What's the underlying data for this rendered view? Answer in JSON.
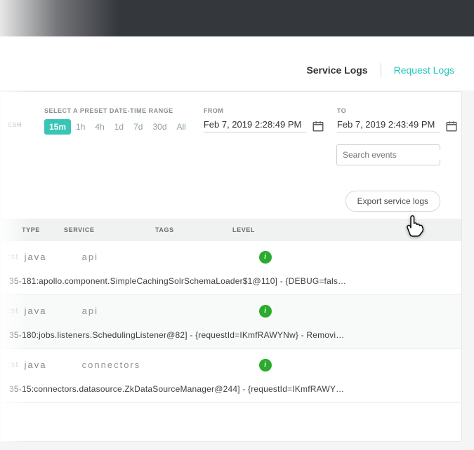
{
  "tabs": {
    "active": "Service Logs",
    "inactive": "Request Logs"
  },
  "filters": {
    "refresh_partial": "ESH",
    "preset_label": "SELECT A PRESET DATE-TIME RANGE",
    "presets": [
      "15m",
      "1h",
      "4h",
      "1d",
      "7d",
      "30d",
      "All"
    ],
    "active_preset": "15m",
    "from_label": "FROM",
    "from_value": "Feb 7, 2019 2:28:49 PM",
    "to_label": "TO",
    "to_value": "Feb 7, 2019 2:43:49 PM"
  },
  "search": {
    "placeholder": "Search events"
  },
  "export": {
    "label": "Export service logs"
  },
  "table": {
    "headers": {
      "type": "TYPE",
      "service": "SERVICE",
      "tags": "TAGS",
      "level": "LEVEL"
    },
    "rows": [
      {
        "st": ":st",
        "type": "java",
        "service": "api",
        "level": "i",
        "detail_pre": "35-181:apollo.component.",
        "detail_dark": "SimpleCachingSolrSchemaLoader$1@110] - {DEBUG=fals…",
        "alt": false
      },
      {
        "st": ":st",
        "type": "java",
        "service": "api",
        "level": "i",
        "detail_pre": "35-180:jobs.listeners.Sch",
        "detail_dark": "edulingListener@82] - {requestId=IKmfRAWYNw} - Removi…",
        "alt": true
      },
      {
        "st": ":st",
        "type": "java",
        "service": "connectors",
        "level": "i",
        "detail_pre": "35-15:connectors.datasou",
        "detail_dark": "rce.ZkDataSourceManager@244] - {requestId=IKmfRAWY…",
        "alt": false
      }
    ]
  }
}
